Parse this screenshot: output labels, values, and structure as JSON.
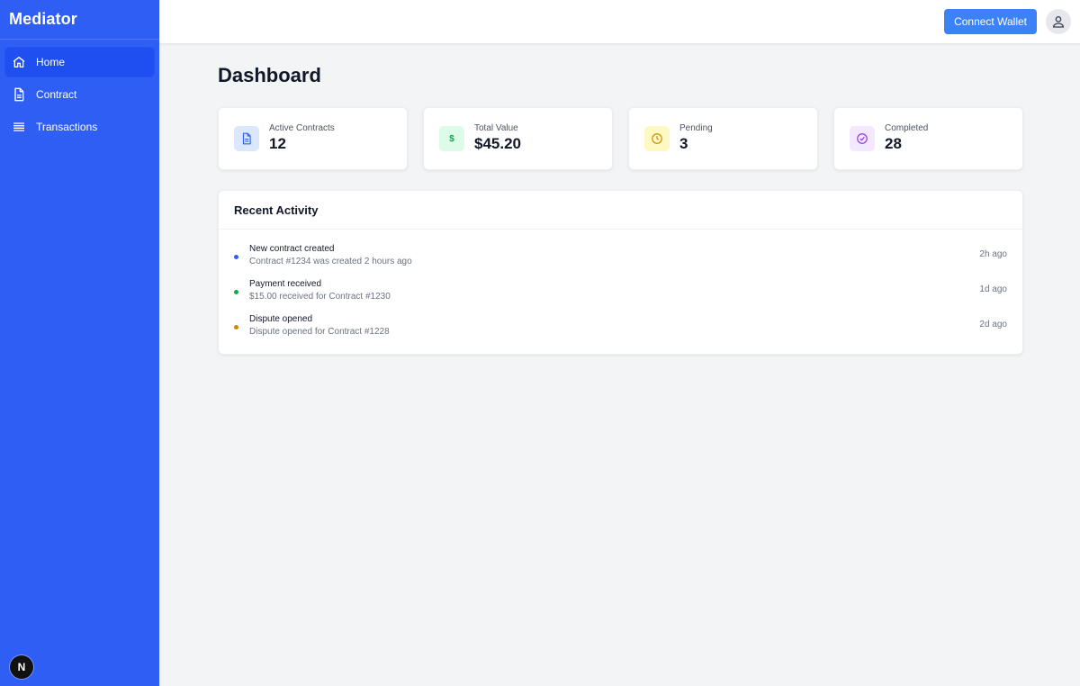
{
  "app": {
    "brand": "Mediator",
    "badge": "N"
  },
  "sidebar": {
    "items": [
      {
        "label": "Home",
        "icon": "home-icon",
        "active": true
      },
      {
        "label": "Contract",
        "icon": "document-icon",
        "active": false
      },
      {
        "label": "Transactions",
        "icon": "list-icon",
        "active": false
      }
    ]
  },
  "topbar": {
    "connect_label": "Connect Wallet",
    "avatar_icon": "user-icon"
  },
  "page": {
    "title": "Dashboard"
  },
  "stats": [
    {
      "label": "Active Contracts",
      "value": "12",
      "icon": "document-icon",
      "bg": "#dbe7fb",
      "fg": "#2f5ef5"
    },
    {
      "label": "Total Value",
      "value": "$45.20",
      "icon": "dollar-icon",
      "bg": "#dcfce7",
      "fg": "#16a34a"
    },
    {
      "label": "Pending",
      "value": "3",
      "icon": "clock-icon",
      "bg": "#fef9c3",
      "fg": "#ca8a04"
    },
    {
      "label": "Completed",
      "value": "28",
      "icon": "check-circle-icon",
      "bg": "#f3e8ff",
      "fg": "#9333ea"
    }
  ],
  "activity": {
    "title": "Recent Activity",
    "items": [
      {
        "title": "New contract created",
        "desc": "Contract #1234 was created 2 hours ago",
        "time": "2h ago",
        "dot": "#2f5ef5"
      },
      {
        "title": "Payment received",
        "desc": "$15.00 received for Contract #1230",
        "time": "1d ago",
        "dot": "#16a34a"
      },
      {
        "title": "Dispute opened",
        "desc": "Dispute opened for Contract #1228",
        "time": "2d ago",
        "dot": "#ca8a04"
      }
    ]
  },
  "colors": {
    "sidebar": "#2f5ef5",
    "accent": "#3b82f6",
    "page_bg": "#f3f4f6"
  }
}
